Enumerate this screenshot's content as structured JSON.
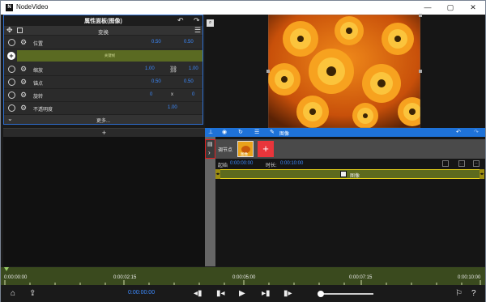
{
  "app": {
    "title": "NodeVideo",
    "logo": "N",
    "window_controls": [
      "—",
      "▢",
      "✕"
    ]
  },
  "props": {
    "header": "属性面板(图像)",
    "section": "变换",
    "keyframe_hint": "关键帧",
    "more": "更多...",
    "rows": [
      {
        "label": "位置",
        "v1": "0.50",
        "v2": "0.50"
      },
      {
        "label": "缩放",
        "v1": "1.00",
        "v2": "1.00"
      },
      {
        "label": "锚点",
        "v1": "0.50",
        "v2": "0.50"
      },
      {
        "label": "旋转",
        "v1": "0",
        "mid": "x",
        "v2": "0"
      },
      {
        "label": "不透明度",
        "v1": "1.00"
      }
    ]
  },
  "toolbar": {
    "label": "图像"
  },
  "add": "+",
  "timeline": {
    "start_label": "起始",
    "start_value": "0:00:00:00",
    "duration_label": "时长:",
    "duration_value": "0:00:10:00",
    "node_label": "调节点",
    "thumb_label": "图像",
    "clip_label": "图像"
  },
  "ruler": {
    "ticks": [
      "0:00:00:00",
      "0:00:02:15",
      "0:00:05:00",
      "0:00:07:15",
      "0:00:10:00"
    ]
  },
  "bottom": {
    "timecode": "0:00:00:00",
    "playhead_fraction": 0.02
  },
  "colors": {
    "accent": "#1e72d8",
    "value_blue": "#3d8bff",
    "clip_yellow": "#e8d21a",
    "ruler_green": "#3a4a1e",
    "add_red": "#e8353b"
  }
}
